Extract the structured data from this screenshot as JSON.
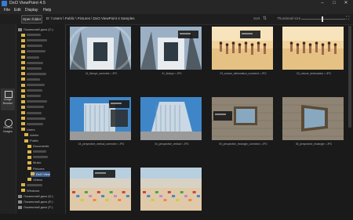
{
  "window": {
    "title": "DxO ViewPoint 4.5",
    "controls": [
      "–",
      "□",
      "✕"
    ]
  },
  "menu": [
    "File",
    "Edit",
    "Display",
    "Help"
  ],
  "toolbar": {
    "open_folder": "Open folder",
    "path": "D: \\ Users \\ Public \\ Pictures \\ DxO ViewPoint 4 Samples",
    "sort": "Sort",
    "thumbnail_size_label": "Thumbnail size",
    "thumbnail_size_fraction": 0.48
  },
  "left_rail": [
    {
      "label": "Image Browser",
      "icon": "image-browser-icon",
      "active": true
    },
    {
      "label": "Recent Images",
      "icon": "recent-icon",
      "active": false
    }
  ],
  "tree": [
    {
      "label": "Локальный диск (C:)",
      "depth": 0,
      "kind": "drive"
    },
    {
      "label": "",
      "depth": 1,
      "kind": "folder"
    },
    {
      "label": "",
      "depth": 1,
      "kind": "folder"
    },
    {
      "label": "",
      "depth": 1,
      "kind": "folder"
    },
    {
      "label": "",
      "depth": 1,
      "kind": "folder"
    },
    {
      "label": "",
      "depth": 1,
      "kind": "folder"
    },
    {
      "label": "",
      "depth": 1,
      "kind": "folder"
    },
    {
      "label": "",
      "depth": 1,
      "kind": "folder"
    },
    {
      "label": "",
      "depth": 1,
      "kind": "folder"
    },
    {
      "label": "",
      "depth": 1,
      "kind": "folder"
    },
    {
      "label": "",
      "depth": 1,
      "kind": "folder"
    },
    {
      "label": "",
      "depth": 1,
      "kind": "folder"
    },
    {
      "label": "",
      "depth": 1,
      "kind": "folder"
    },
    {
      "label": "",
      "depth": 1,
      "kind": "folder"
    },
    {
      "label": "",
      "depth": 1,
      "kind": "folder"
    },
    {
      "label": "",
      "depth": 1,
      "kind": "folder"
    },
    {
      "label": "",
      "depth": 1,
      "kind": "folder"
    },
    {
      "label": "",
      "depth": 1,
      "kind": "folder"
    },
    {
      "label": "Users",
      "depth": 1,
      "kind": "folder"
    },
    {
      "label": "Admin",
      "depth": 2,
      "kind": "folder"
    },
    {
      "label": "Public",
      "depth": 2,
      "kind": "folder"
    },
    {
      "label": "Documents",
      "depth": 3,
      "kind": "folder"
    },
    {
      "label": "",
      "depth": 3,
      "kind": "folder"
    },
    {
      "label": "",
      "depth": 3,
      "kind": "folder"
    },
    {
      "label": "Music",
      "depth": 3,
      "kind": "folder"
    },
    {
      "label": "Pictures",
      "depth": 3,
      "kind": "folder"
    },
    {
      "label": "DxO View",
      "depth": 4,
      "kind": "folder",
      "selected": true
    },
    {
      "label": "Videos",
      "depth": 3,
      "kind": "folder"
    },
    {
      "label": "",
      "depth": 1,
      "kind": "folder"
    },
    {
      "label": "Windows",
      "depth": 1,
      "kind": "folder"
    },
    {
      "label": "Локальный диск (D:)",
      "depth": 0,
      "kind": "drive"
    },
    {
      "label": "Локальный диск (E:)",
      "depth": 0,
      "kind": "drive"
    },
    {
      "label": "Локальный диск (F:)",
      "depth": 0,
      "kind": "drive"
    }
  ],
  "thumbnails": [
    {
      "caption": "01_fisheye_corrected = JPG",
      "scene": "fisheye-corrected"
    },
    {
      "caption": "01_fisheye = JPG",
      "scene": "fisheye"
    },
    {
      "caption": "03_volume_deformation_corrected = JPG",
      "scene": "beach-corrected"
    },
    {
      "caption": "03_volume_deformation = JPG",
      "scene": "beach"
    },
    {
      "caption": "04_perspective_vertical_corrected = JPG",
      "scene": "building-corrected"
    },
    {
      "caption": "04_perspective_vertical = JPG",
      "scene": "building"
    },
    {
      "caption": "05_perspective_rectangle_corrected = JPG",
      "scene": "wall-corrected"
    },
    {
      "caption": "05_perspective_rectangle = JPG",
      "scene": "wall"
    },
    {
      "caption": "",
      "scene": "city-corrected"
    },
    {
      "caption": "",
      "scene": "city"
    }
  ]
}
